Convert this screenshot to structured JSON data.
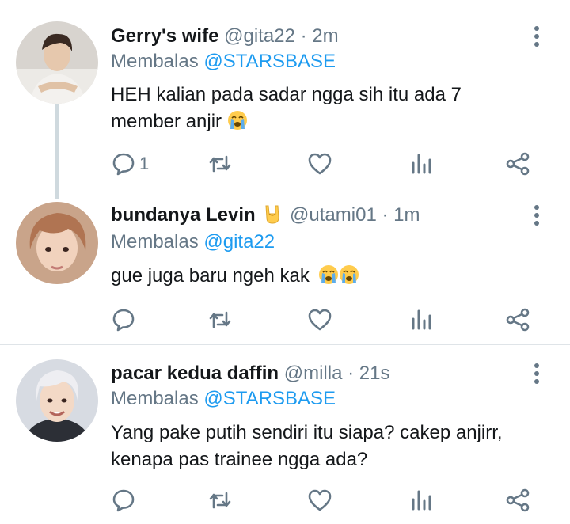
{
  "tweets": [
    {
      "name": "Gerry's wife",
      "handle": "@gita22",
      "dot": "·",
      "time": "2m",
      "reply_prefix": "Membalas ",
      "reply_mention": "@STARSBASE",
      "text_line1": "HEH kalian pada sadar ngga sih itu ada 7",
      "text_line2": "member anjir",
      "reply_count": "1"
    },
    {
      "name": "bundanya Levin",
      "handle": "@utami01",
      "dot": "·",
      "time": "1m",
      "reply_prefix": "Membalas ",
      "reply_mention": "@gita22",
      "text_line1": "gue juga baru ngeh kak",
      "reply_count": ""
    },
    {
      "name": "pacar kedua daffin",
      "handle": "@milla",
      "dot": "·",
      "time": "21s",
      "reply_prefix": "Membalas ",
      "reply_mention": "@STARSBASE",
      "text_line1": "Yang pake putih sendiri itu siapa? cakep anjirr,",
      "text_line2": "kenapa pas trainee ngga ada?",
      "reply_count": ""
    }
  ],
  "icons": {
    "reply": "reply-icon",
    "retweet": "retweet-icon",
    "like": "heart-icon",
    "stats": "analytics-icon",
    "share": "share-icon",
    "more": "more-icon",
    "crying_emoji": "loudly-crying-face-emoji",
    "rock_emoji": "sign-of-the-horns-emoji"
  },
  "colors": {
    "mention": "#1d9bf0",
    "secondary_text": "#657786",
    "icon": "#657786",
    "thread_line": "#cfd9de"
  }
}
